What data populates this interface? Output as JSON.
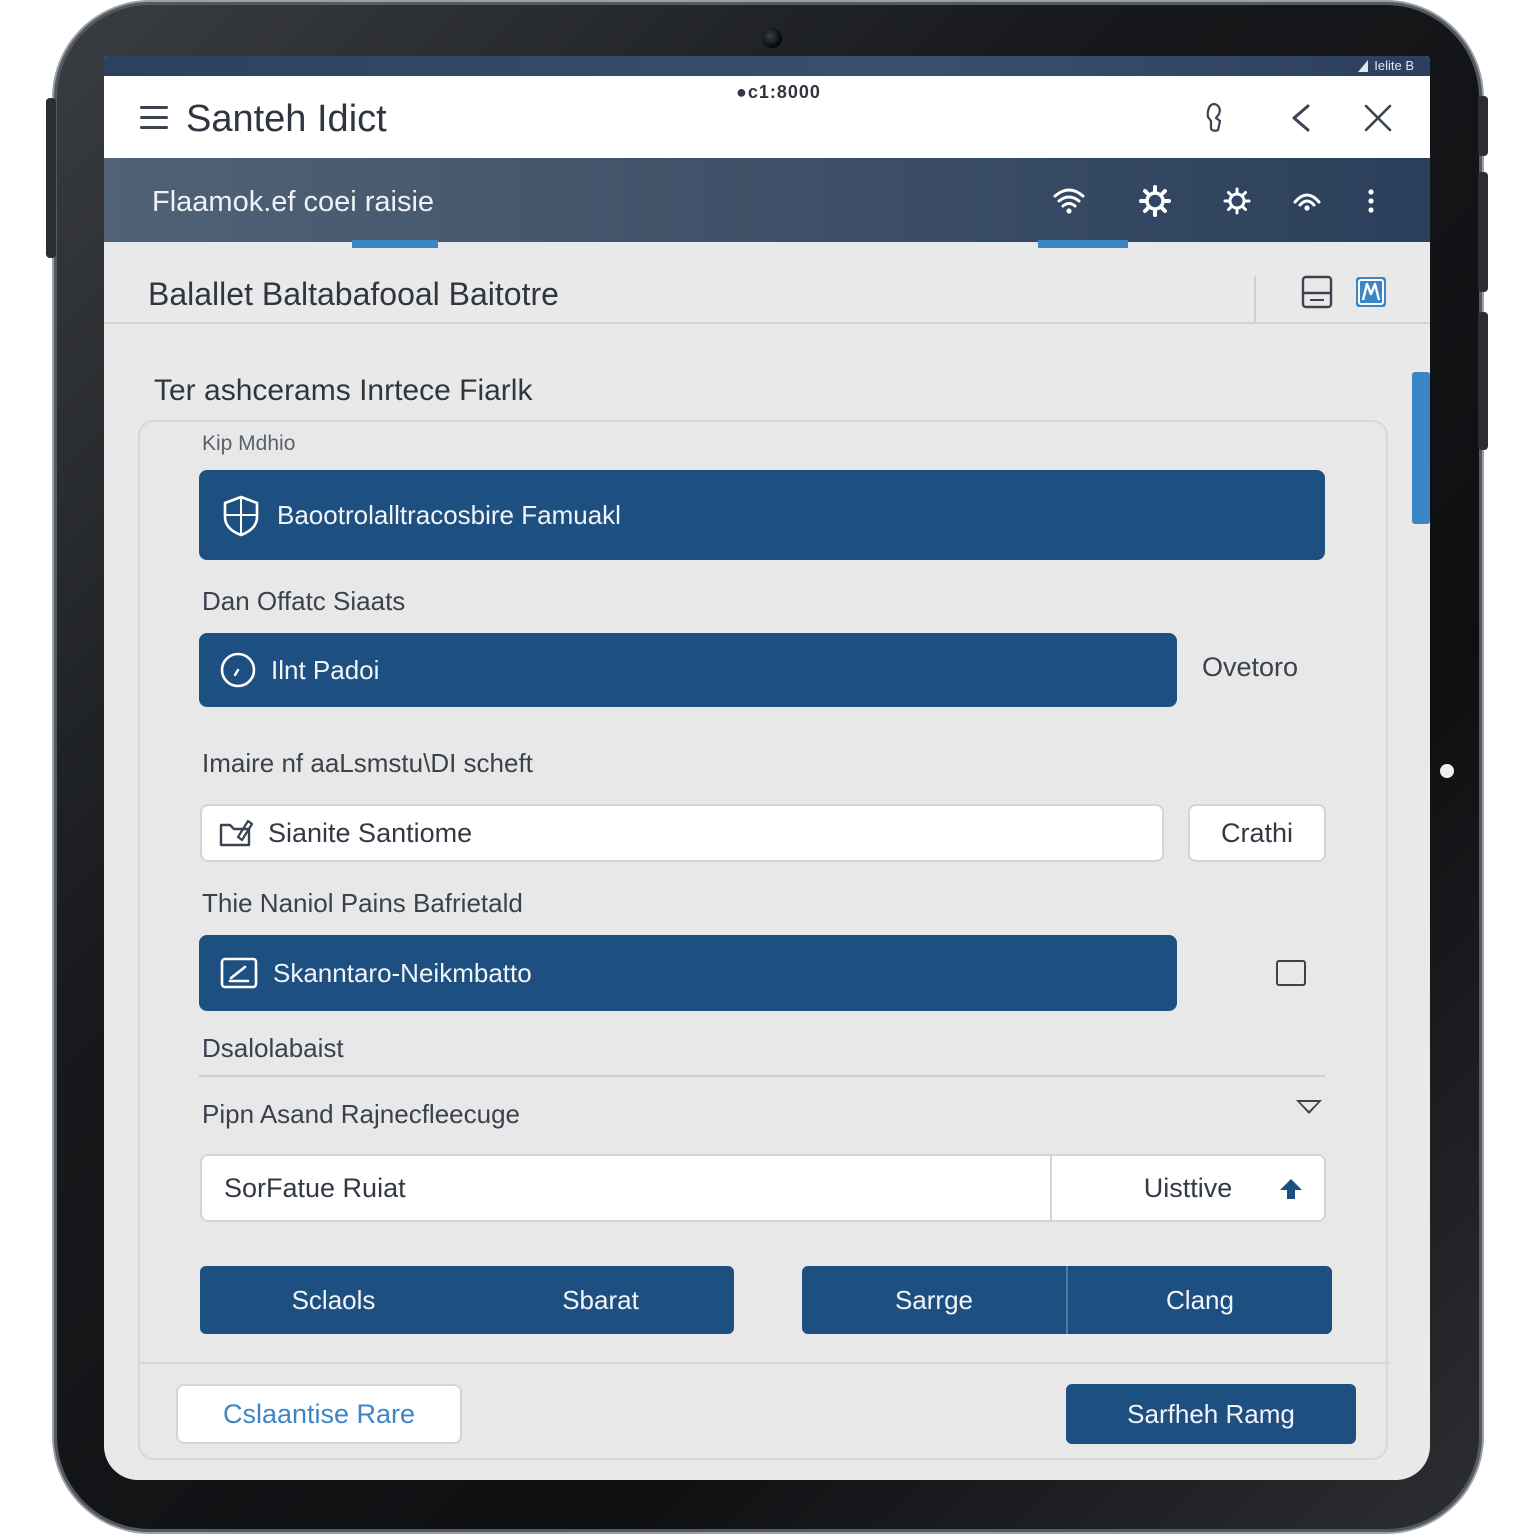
{
  "status_bar": {
    "right_text": "Ielite B"
  },
  "app_bar": {
    "title": "Santeh Idict",
    "clock": "●c1:8000",
    "icons": [
      "hand-pointer-icon",
      "back-arrow-icon",
      "close-icon"
    ]
  },
  "sub_bar": {
    "title": "Flaamok.ef coei raisie",
    "icons": [
      "wifi-icon",
      "gear-icon",
      "settings-icon",
      "signal-icon",
      "more-vert-icon"
    ]
  },
  "section": {
    "title": "Balallet Baltabafooal Baitotre",
    "icons": [
      "panel-icon",
      "edit-icon"
    ]
  },
  "group": {
    "title": "Ter ashcerams Inrtece Fiarlk"
  },
  "form": {
    "small_label": "Kip Mdhio",
    "bar1": {
      "icon": "shield-icon",
      "text": "Baootrolalltracosbire Famuakl"
    },
    "label2": "Dan Offatc Siaats",
    "bar2": {
      "icon": "clock-icon",
      "text": "Ilnt Padoi",
      "side": "Ovetoro"
    },
    "label3": "Imaire nf aaLsmstu\\DI scheft",
    "field3": {
      "icon": "folder-edit-icon",
      "value": "Sianite Santiome",
      "button": "Crathi"
    },
    "label4": "Thie Naniol Pains Bafrietald",
    "bar4": {
      "icon": "edit-box-icon",
      "text": "Skanntaro-Neikmbatto"
    },
    "label5": "Dsalolabaist",
    "dropdown_label": "Pipn Asand Rajnecfleecuge",
    "split": {
      "left": "SorFatue Ruiat",
      "right": "Uisttive",
      "right_icon": "up-arrow-icon"
    },
    "dual1": [
      "Sclaols",
      "Sbarat"
    ],
    "dual2": [
      "Sarrge",
      "Clang"
    ]
  },
  "footer": {
    "secondary": "Cslaantise Rare",
    "primary": "Sarfheh Ramg"
  },
  "colors": {
    "primary": "#1e4f81",
    "accent": "#3d86c6",
    "header_dark": "#2b3f5c"
  }
}
